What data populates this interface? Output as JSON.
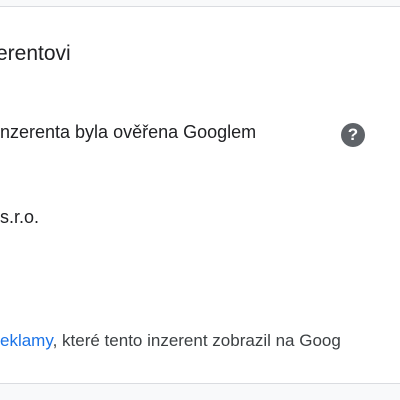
{
  "section": {
    "title": "erentovi"
  },
  "verification": {
    "text": "nzerenta byla ověřena Googlem",
    "help_icon": "question-mark-icon",
    "help_glyph": "?"
  },
  "advertiser": {
    "name": "s.r.o."
  },
  "ads": {
    "link_text": "eklamy",
    "rest_text": ", které tento inzerent zobrazil na Goog"
  },
  "colors": {
    "link": "#1a73e8",
    "text": "#202124",
    "icon": "#5f6368",
    "divider": "#dadce0"
  }
}
